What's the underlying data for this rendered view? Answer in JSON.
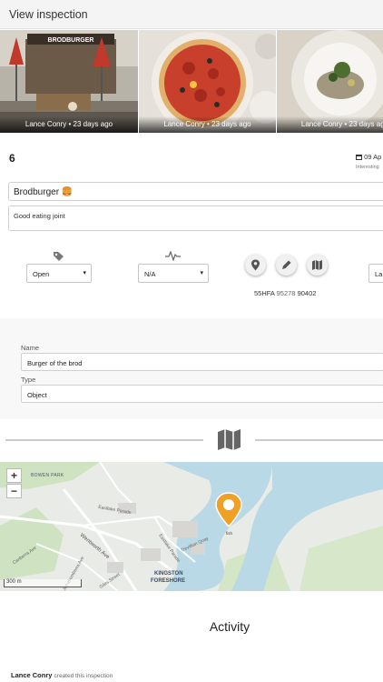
{
  "header": {
    "title": "View inspection"
  },
  "gallery": [
    {
      "caption": "Lance Conry • 23 days ago",
      "alt": "restaurant-exterior"
    },
    {
      "caption": "Lance Conry • 23 days ago",
      "alt": "pizza"
    },
    {
      "caption": "Lance Conry • 23 days ago",
      "alt": "plated-dish"
    }
  ],
  "sign": {
    "banner": "BRODBURGER"
  },
  "inspection": {
    "number": "6",
    "date": "09 Ap",
    "date_sub": "Interesting",
    "name": "Brodburger 🍔",
    "note": "Good eating joint"
  },
  "controls": {
    "status_value": "Open",
    "health_value": "N/A",
    "extra_value": "La",
    "icons": {
      "status": "tag-icon",
      "health": "heartbeat-icon",
      "location": "map-pin-icon",
      "edit": "pencil-icon",
      "map": "map-icon",
      "calendar": "calendar-icon"
    },
    "grid_ref": {
      "a": "55HFA",
      "b": "95278",
      "c": "90402"
    }
  },
  "details": {
    "name_label": "Name",
    "name_value": "Burger of the brod",
    "type_label": "Type",
    "type_value": "Object"
  },
  "map": {
    "zoom_in": "+",
    "zoom_out": "−",
    "scale_label": "300 m",
    "labels": {
      "bowen_park": "BOWEN PARK",
      "eastlake": "Eastlake Parade",
      "wentworth": "Wentworth Ave",
      "trevillian": "Trevillian Quay",
      "eastlake2": "Eastlake Parade",
      "kingston": "KINGSTON",
      "foreshore": "FORESHORE",
      "jerrabomberra": "Jerrabomberra Ave",
      "giles": "Giles Street",
      "canberra": "Canberra Ave",
      "pin_label": "fish"
    },
    "accent": "#f0a024"
  },
  "activity": {
    "title": "Activity",
    "entries": [
      {
        "user": "Lance Conry",
        "action": "created this inspection"
      }
    ]
  }
}
